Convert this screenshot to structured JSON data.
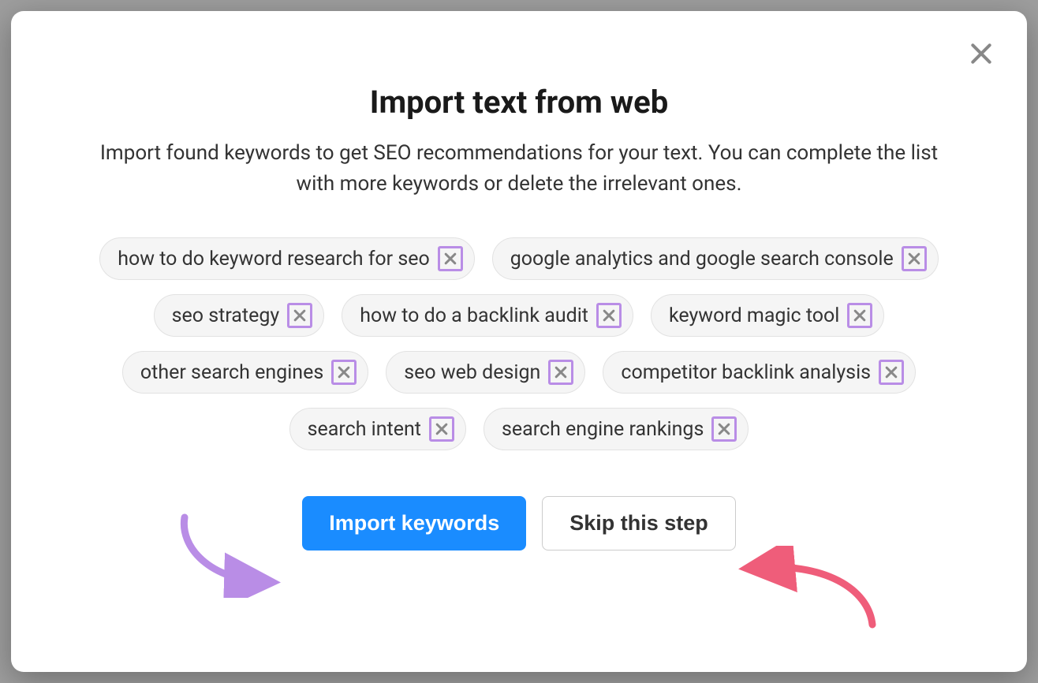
{
  "modal": {
    "title": "Import text from web",
    "subtitle": "Import found keywords to get SEO recommendations for your text. You can complete the list with more keywords or delete the irrelevant ones.",
    "keywords": [
      "how to do keyword research for seo",
      "google analytics and google search console",
      "seo strategy",
      "how to do a backlink audit",
      "keyword magic tool",
      "other search engines",
      "seo web design",
      "competitor backlink analysis",
      "search intent",
      "search engine rankings"
    ],
    "primary_button": "Import keywords",
    "secondary_button": "Skip this step"
  }
}
